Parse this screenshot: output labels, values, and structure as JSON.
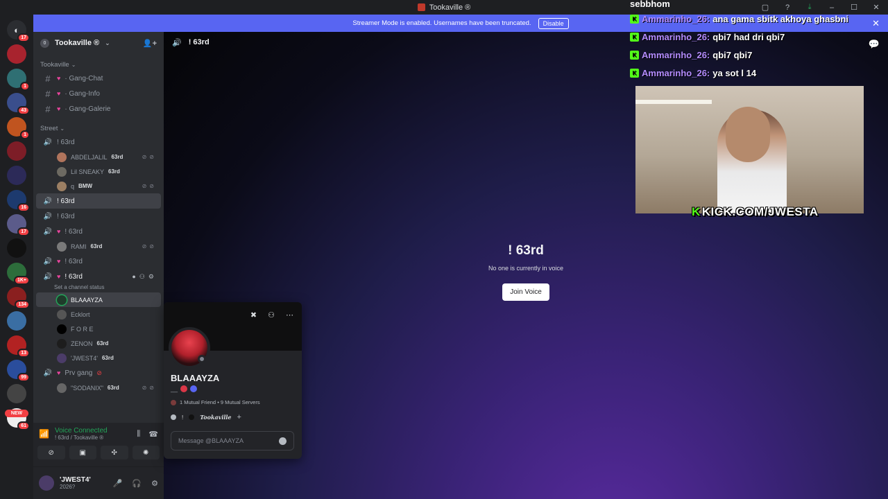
{
  "titlebar": {
    "title": "Tookaville ®"
  },
  "banner": {
    "text": "Streamer Mode is enabled. Usernames have been truncated.",
    "disable_label": "Disable"
  },
  "rail": {
    "badges": [
      "17",
      "1",
      "43",
      "1",
      "16",
      "17",
      "1K+",
      "134",
      "13",
      "99",
      "61"
    ],
    "new_label": "NEW"
  },
  "guild": {
    "name": "Tookaville ®",
    "boost": "0"
  },
  "categories": {
    "tookaville": "Tookaville",
    "street": "Street"
  },
  "text_channels": [
    "· Gang-Chat",
    "· Gang-Info",
    "· Gang-Galerie"
  ],
  "voice": {
    "ch1": "! 63rd",
    "ch1_users": [
      {
        "name": "ABDELJALIL",
        "tag": "63rd"
      },
      {
        "name": "Lil SNEAKY",
        "tag": "63rd"
      },
      {
        "name": "q",
        "tag": "BMW"
      }
    ],
    "ch2": "! 63rd",
    "ch3": "! 63rd",
    "ch4": "! 63rd",
    "ch4_users": [
      {
        "name": "RAMI",
        "tag": "63rd"
      }
    ],
    "ch5": "! 63rd",
    "ch6": "! 63rd",
    "ch6_status": "Set a channel status",
    "ch6_users": [
      {
        "name": "BLAAAYZA",
        "tag": ""
      },
      {
        "name": "Ecklort",
        "tag": ""
      },
      {
        "name": "F O R E",
        "tag": ""
      },
      {
        "name": "ZENON",
        "tag": "63rd"
      },
      {
        "name": "'JWEST4'",
        "tag": "63rd"
      }
    ],
    "ch7": "Prv gang",
    "ch7_users": [
      {
        "name": "\"SODANIX\"",
        "tag": "63rd"
      }
    ]
  },
  "voice_panel": {
    "status": "Voice Connected",
    "sub": "! 63rd / Tookaville ®"
  },
  "user_panel": {
    "name": "'JWEST4'",
    "status": "2026?"
  },
  "main": {
    "channel": "! 63rd",
    "title": "! 63rd",
    "subtitle": "No one is currently in voice",
    "join_label": "Join Voice"
  },
  "popout": {
    "name": "BLAAAYZA",
    "pronoun_prefix": "__",
    "mutuals": "1 Mutual Friend • 9 Mutual Servers",
    "role1": "!",
    "role2": "Tookaville",
    "message_placeholder": "Message @BLAAAYZA"
  },
  "overlay": {
    "header": "sebbhom",
    "lines": [
      {
        "user": "Ammarinho_26:",
        "msg": "ana gama sbitk akhoya ghasbni"
      },
      {
        "user": "Ammarinho_26:",
        "msg": "qbi7 had dri qbi7"
      },
      {
        "user": "Ammarinho_26:",
        "msg": "qbi7 qbi7"
      },
      {
        "user": "Ammarinho_26:",
        "msg": "ya sot l 14"
      }
    ],
    "kick_text": "KICK.COM/JWESTA"
  },
  "colors": {
    "accent": "#5865f2",
    "green": "#23a559",
    "kick": "#53fc18"
  }
}
